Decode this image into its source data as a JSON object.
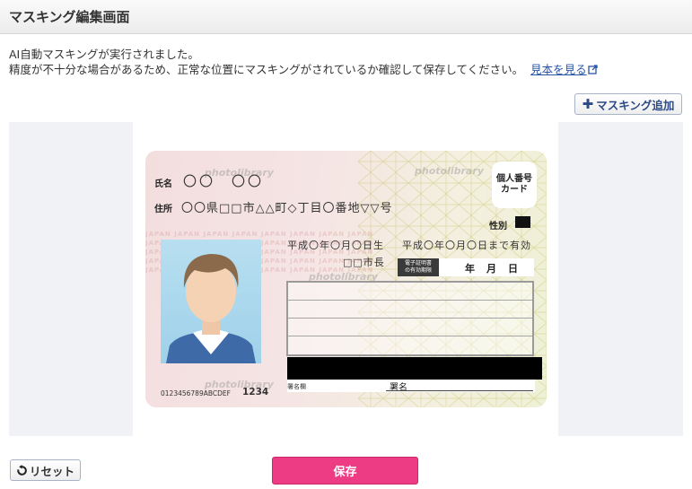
{
  "header": {
    "title": "マスキング編集画面"
  },
  "description": {
    "line1": "AI自動マスキングが実行されました。",
    "line2": "精度が不十分な場合があるため、正常な位置にマスキングがされているか確認して保存してください。",
    "sample_link": "見本を見る"
  },
  "toolbar": {
    "add_mask_label": "マスキング追加"
  },
  "card": {
    "name_label": "氏名",
    "name_value": "〇〇　〇〇",
    "address_label": "住所",
    "address_value": "〇〇県□□市△△町◇丁目〇番地▽▽号",
    "kojin_label_1": "個人番号",
    "kojin_label_2": "カード",
    "sex_label": "性別",
    "birth_value": "平成〇年〇月〇日生",
    "expiry_value": "平成〇年〇月〇日まで有効",
    "issuer_value": "□□市長",
    "cert_label_1": "電子証明書",
    "cert_label_2": "の有効期限",
    "cert_ymd": "年　月　日",
    "sign_mid": "署名欄",
    "sign_label": "署名",
    "card_number": "0123456789ABCDEF",
    "card_number4": "1234",
    "watermark": "photolibrary",
    "japan_strip": "JAPAN JAPAN JAPAN JAPAN JAPAN JAPAN JAPAN JAPAN"
  },
  "buttons": {
    "reset_label": "リセット",
    "save_label": "保存"
  },
  "colors": {
    "save_bg": "#ed3b84",
    "link": "#2a56a6",
    "accent_text": "#2c4a86"
  }
}
